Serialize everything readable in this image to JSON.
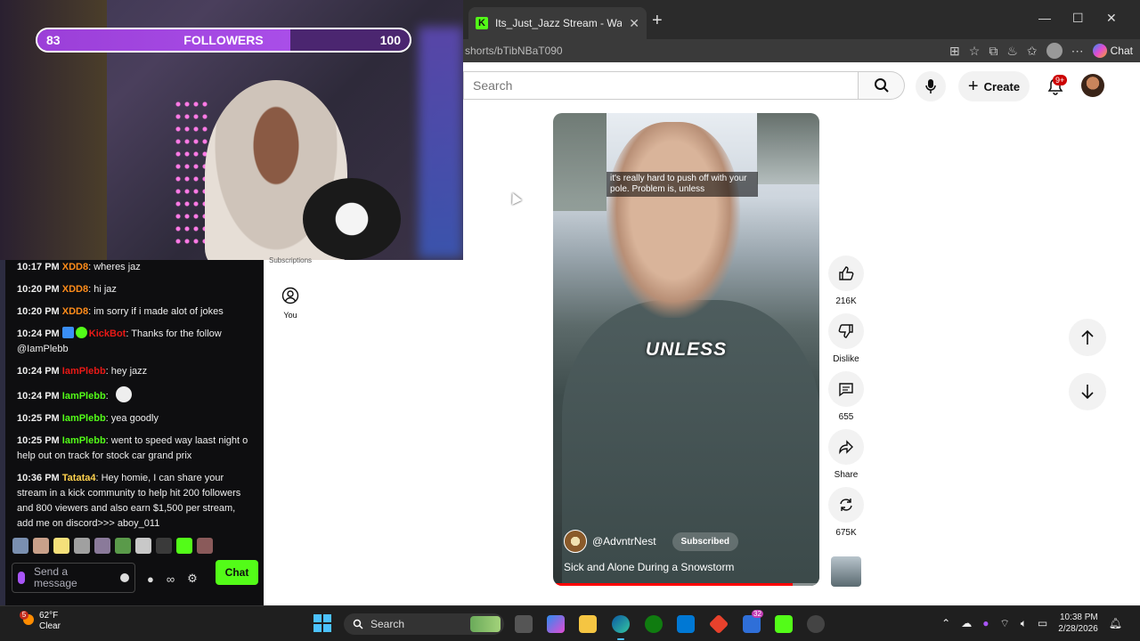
{
  "webcam": {
    "followers_goal": {
      "label": "FOLLOWERS",
      "current": "83",
      "goal": "100",
      "progress": 0.83
    }
  },
  "chat": {
    "messages": [
      {
        "time": "10:17 PM",
        "user": "XDD8",
        "user_color": "#ff8c1a",
        "text": ": wheres jaz"
      },
      {
        "time": "10:20 PM",
        "user": "XDD8",
        "user_color": "#ff8c1a",
        "text": ": hi jaz"
      },
      {
        "time": "10:20 PM",
        "user": "XDD8",
        "user_color": "#ff8c1a",
        "text": ": im sorry if i made alot of jokes"
      },
      {
        "time": "10:24 PM",
        "user": "KickBot",
        "user_color": "#e91916",
        "text": ": Thanks for the follow @IamPlebb",
        "badges": true
      },
      {
        "time": "10:24 PM",
        "user": "IamPlebb",
        "user_color": "#e91916",
        "text": ": hey jazz"
      },
      {
        "time": "10:24 PM",
        "user": "IamPlebb",
        "user_color": "#53fc18",
        "text": ":",
        "emote": true
      },
      {
        "time": "10:25 PM",
        "user": "IamPlebb",
        "user_color": "#53fc18",
        "text": ": yea goodly"
      },
      {
        "time": "10:25 PM",
        "user": "IamPlebb",
        "user_color": "#53fc18",
        "text": ": went to speed way laast night o help out on track for stock car grand prix"
      },
      {
        "time": "10:36 PM",
        "user": "Tatata4",
        "user_color": "#ffd24d",
        "text": ": Hey homie, I can share your stream in a kick community to help hit 200 followers and 800 viewers and also earn $1,500 per stream, add me on discord>>> aboy_011"
      }
    ],
    "input_placeholder": "Send a message",
    "send_label": "Chat",
    "infinity_icon": "∞"
  },
  "browser": {
    "tab_title": "Its_Just_Jazz Stream - Watch Live o",
    "url": "shorts/bTibNBaT090",
    "chat_label": "Chat",
    "search_placeholder": "Search",
    "create_label": "Create",
    "notif_badge": "9+",
    "sidebar": {
      "you_label": "You",
      "subscriptions_cut": "Subscriptions"
    },
    "short": {
      "caption": "it's really hard to push off with your pole. Problem is, unless",
      "overlay_word": "UNLESS",
      "channel": "@AdvntrNest",
      "subscribed_label": "Subscribed",
      "title": "Sick and Alone During a Snowstorm",
      "progress": 0.9
    },
    "actions": {
      "likes": "216K",
      "dislike_label": "Dislike",
      "comments": "655",
      "share_label": "Share",
      "remix": "675K"
    }
  },
  "taskbar": {
    "weather_temp": "62°F",
    "weather_cond": "Clear",
    "weather_badge": "5",
    "search_label": "Search",
    "teams_badge": "32",
    "time": "10:38 PM",
    "date": "2/28/2026"
  }
}
